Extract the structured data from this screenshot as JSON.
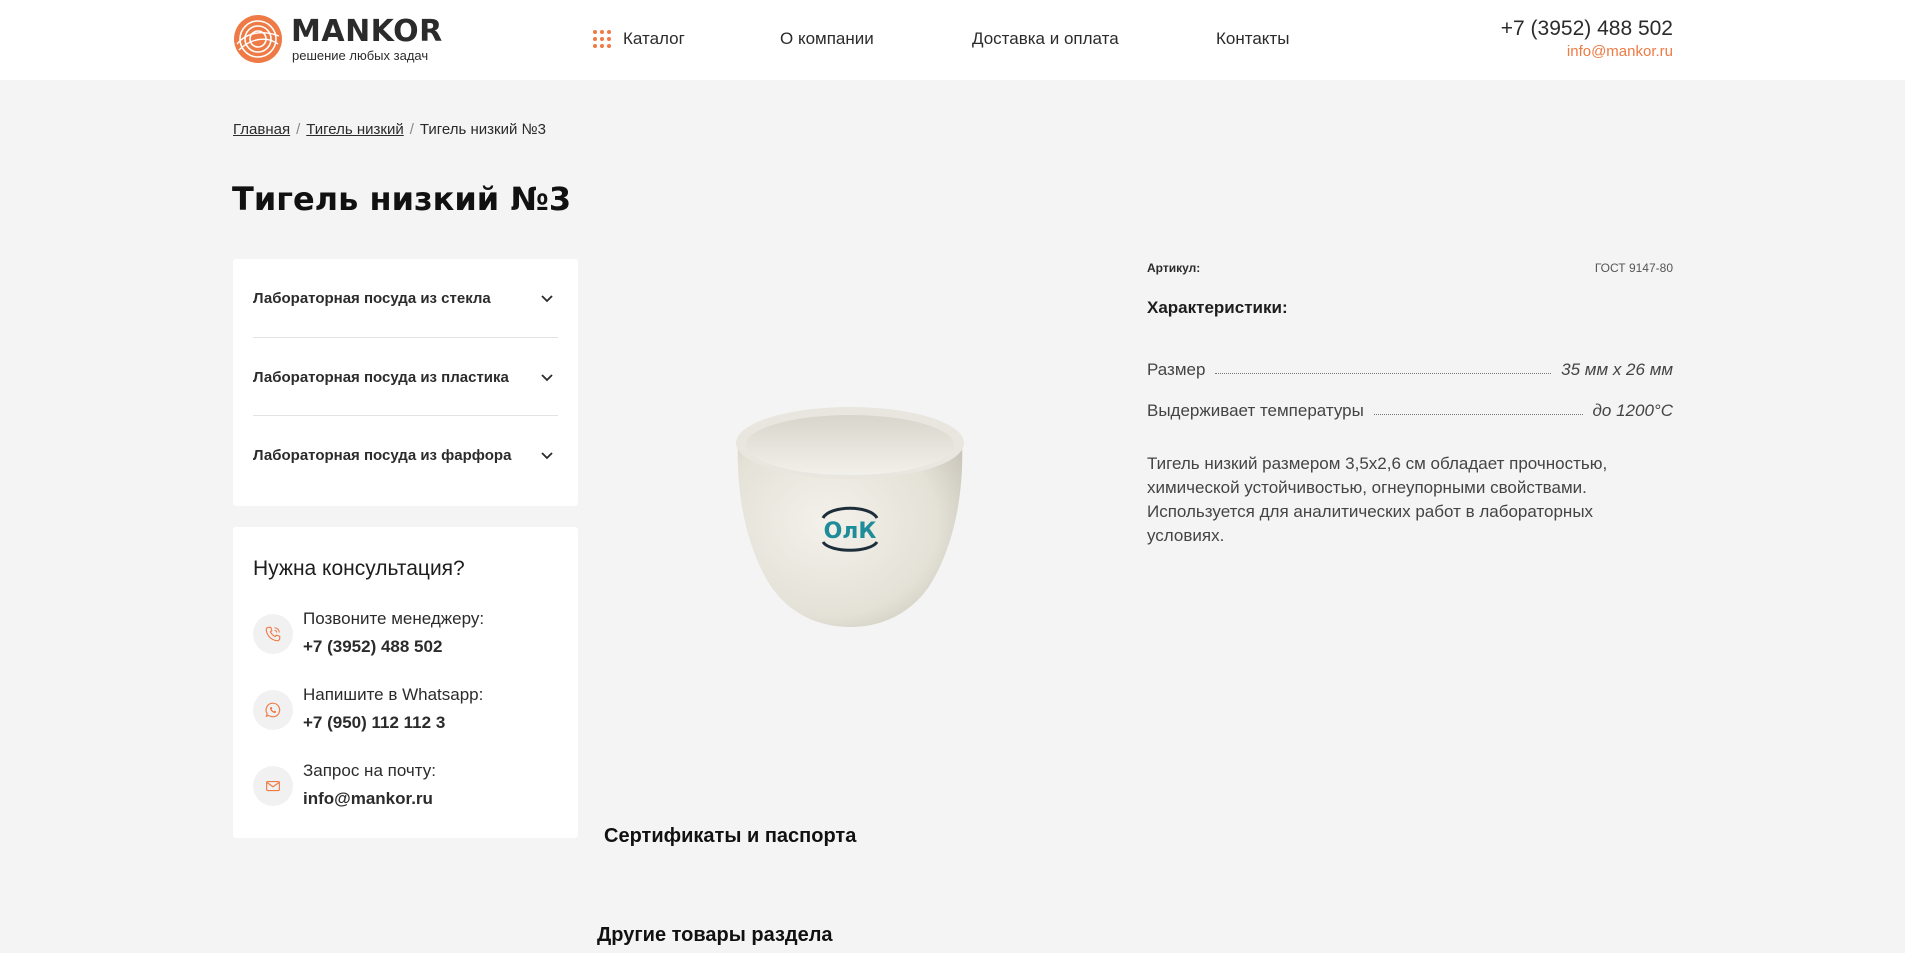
{
  "header": {
    "logo_name": "MANKOR",
    "logo_tagline": "решение любых задач",
    "nav": {
      "catalog": "Каталог",
      "about": "О компании",
      "delivery": "Доставка и оплата",
      "contacts": "Контакты"
    },
    "phone": "+7 (3952) 488 502",
    "email": "info@mankor.ru"
  },
  "breadcrumb": {
    "home": "Главная",
    "sep": "/",
    "category": "Тигель низкий",
    "current": "Тигель низкий №3"
  },
  "page_title": "Тигель низкий №3",
  "sidebar": {
    "categories": [
      {
        "label": "Лабораторная посуда из стекла"
      },
      {
        "label": "Лабораторная посуда из пластика"
      },
      {
        "label": "Лабораторная посуда из фарфора"
      }
    ],
    "consult": {
      "title": "Нужна консультация?",
      "rows": [
        {
          "label": "Позвоните менеджеру:",
          "value": "+7 (3952) 488 502",
          "icon": "phone-icon"
        },
        {
          "label": "Напишите в Whatsapp:",
          "value": "+7 (950) 112 112 3",
          "icon": "whatsapp-icon"
        },
        {
          "label": "Запрос на почту:",
          "value": "info@mankor.ru",
          "icon": "mail-icon"
        }
      ]
    }
  },
  "product": {
    "image_mark": "ОлК",
    "sku_label": "Артикул:",
    "sku_value": "ГОСТ 9147-80",
    "specs_title": "Характеристики:",
    "specs": [
      {
        "name": "Размер",
        "value": "35 мм х 26 мм"
      },
      {
        "name": "Выдерживает температуры",
        "value": "до 1200°C"
      }
    ],
    "description": "Тигель низкий размером 3,5х2,6 см обладает прочностью, химической устойчивостью, огнеупорными свойствами. Используется для аналитических работ в лабораторных условиях."
  },
  "sections": {
    "certificates": "Сертификаты и паспорта",
    "other_products": "Другие товары раздела"
  },
  "colors": {
    "accent": "#ee7a45",
    "background": "#f4f4f4",
    "card": "#ffffff",
    "text": "#2b2b2b"
  }
}
